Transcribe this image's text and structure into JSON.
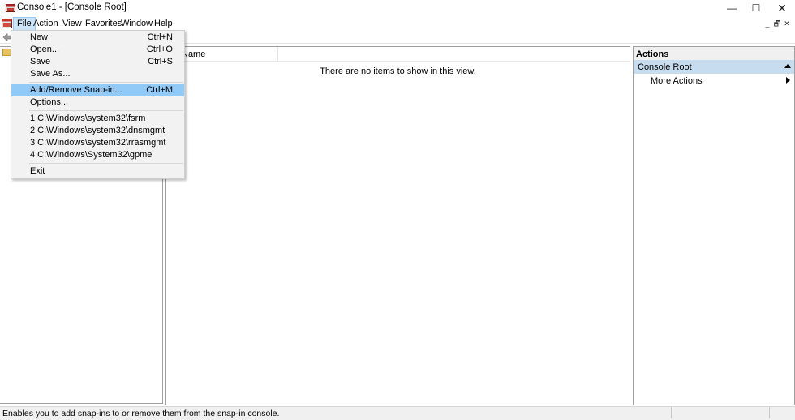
{
  "window": {
    "title": "Console1 - [Console Root]",
    "min_glyph": "—",
    "max_glyph": "☐",
    "close_glyph": "✕"
  },
  "menubar": {
    "items": [
      "File",
      "Action",
      "View",
      "Favorites",
      "Window",
      "Help"
    ],
    "active": "File",
    "inner_controls": [
      "_",
      "🗗",
      "✕"
    ]
  },
  "center": {
    "column_header": "Name",
    "empty_message": "There are no items to show in this view."
  },
  "actions": {
    "title": "Actions",
    "section": "Console Root",
    "items": [
      "More Actions"
    ]
  },
  "file_menu": {
    "items": [
      {
        "label": "New",
        "shortcut": "Ctrl+N"
      },
      {
        "label": "Open...",
        "shortcut": "Ctrl+O"
      },
      {
        "label": "Save",
        "shortcut": "Ctrl+S"
      },
      {
        "label": "Save As...",
        "shortcut": ""
      },
      {
        "label": "Add/Remove Snap-in...",
        "shortcut": "Ctrl+M",
        "highlighted": true
      },
      {
        "label": "Options...",
        "shortcut": ""
      },
      {
        "label": "1 C:\\Windows\\system32\\fsrm",
        "shortcut": ""
      },
      {
        "label": "2 C:\\Windows\\system32\\dnsmgmt",
        "shortcut": ""
      },
      {
        "label": "3 C:\\Windows\\system32\\rrasmgmt",
        "shortcut": ""
      },
      {
        "label": "4 C:\\Windows\\System32\\gpme",
        "shortcut": ""
      },
      {
        "label": "Exit",
        "shortcut": ""
      }
    ]
  },
  "statusbar": {
    "text": "Enables you to add snap-ins to or remove them from the snap-in console."
  },
  "colors": {
    "menu_highlight": "#91c9f7",
    "active_menu": "#cce4f7",
    "actions_selected": "#c7dcef"
  }
}
